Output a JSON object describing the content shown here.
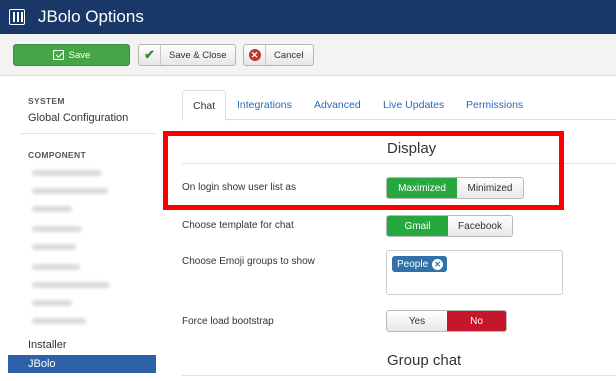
{
  "header": {
    "title": "JBolo Options",
    "logo_icon": "joomla-grid-icon"
  },
  "toolbar": {
    "save_label": "Save",
    "save_close_label": "Save & Close",
    "cancel_label": "Cancel",
    "check_glyph": "✔",
    "cancel_glyph": "✕"
  },
  "sidebar": {
    "system_heading": "SYSTEM",
    "global_config": "Global Configuration",
    "component_heading": "COMPONENT",
    "installer": "Installer",
    "active": "JBolo"
  },
  "tabs": [
    "Chat",
    "Integrations",
    "Advanced",
    "Live Updates",
    "Permissions"
  ],
  "display": {
    "title": "Display",
    "login_label": "On login show user list as",
    "login_options": [
      "Maximized",
      "Minimized"
    ],
    "template_label": "Choose template for chat",
    "template_options": [
      "Gmail",
      "Facebook"
    ],
    "emoji_label": "Choose Emoji groups to show",
    "emoji_chip": "People",
    "emoji_chip_remove": "✕",
    "bootstrap_label": "Force load bootstrap",
    "bootstrap_options": [
      "Yes",
      "No"
    ]
  },
  "group_chat": {
    "title": "Group chat"
  },
  "colors": {
    "header_bg": "#1a3867",
    "save_green": "#46a546",
    "active_green": "#27a83f",
    "no_red": "#c4172c",
    "link_blue": "#2a69b8",
    "highlight_red": "#ff0000",
    "sidebar_active": "#2d62a8"
  }
}
